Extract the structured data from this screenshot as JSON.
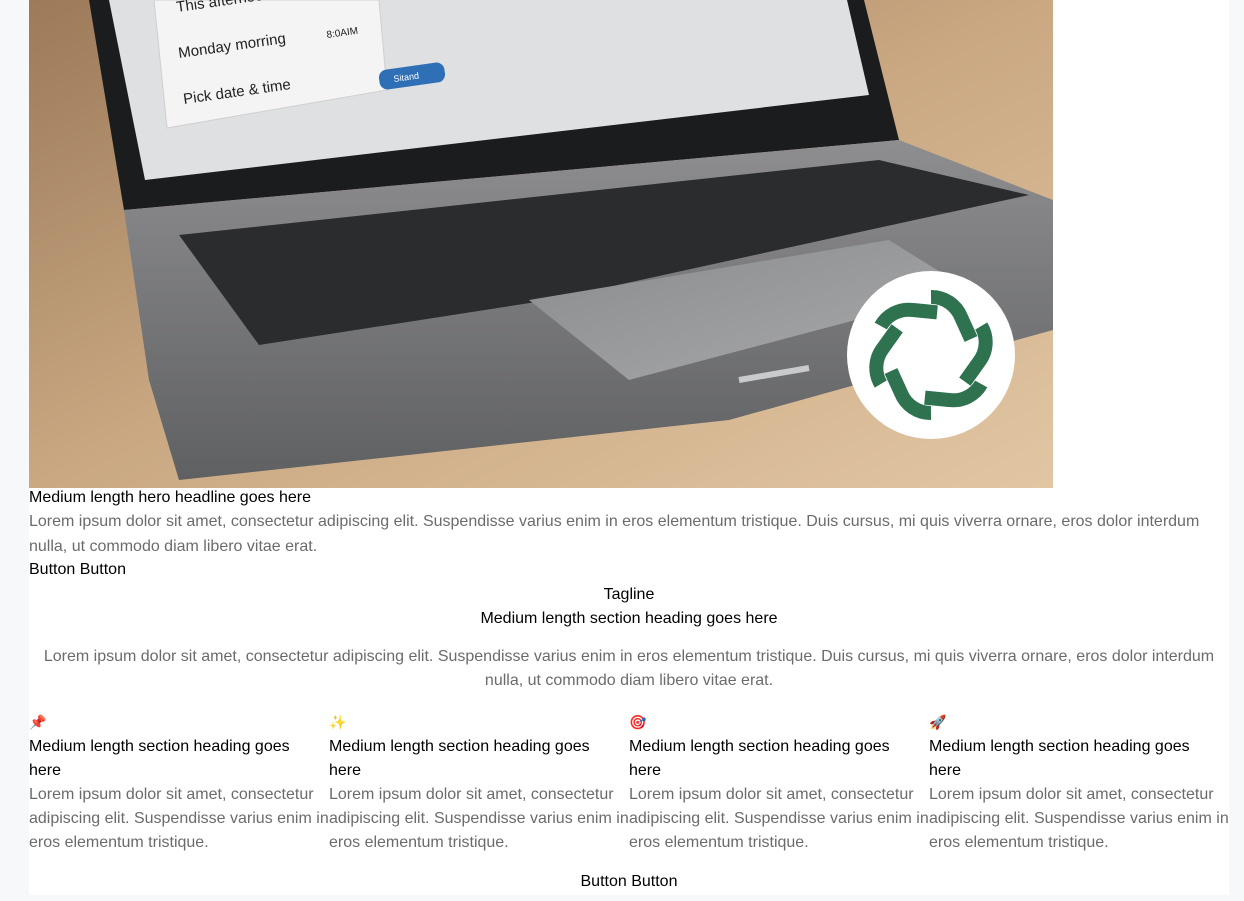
{
  "hero": {
    "image": {
      "menu_items": [
        "This afternoon",
        "Monday morring",
        "Pick date & time"
      ],
      "menu_time": "8:0AIM",
      "send_button": "Sitand"
    },
    "headline": "Medium length hero headline goes here",
    "body": "Lorem ipsum dolor sit amet, consectetur adipiscing elit. Suspendisse varius enim in eros elementum tristique. Duis cursus, mi quis viverra ornare, eros dolor interdum nulla, ut commodo diam libero vitae erat.",
    "button_primary": "Button",
    "button_secondary": "Button"
  },
  "section": {
    "tagline": "Tagline",
    "heading": "Medium length section heading goes here",
    "description": "Lorem ipsum dolor sit amet, consectetur adipiscing elit. Suspendisse varius enim in eros elementum tristique. Duis cursus, mi quis viverra ornare, eros dolor interdum nulla, ut commodo diam libero vitae erat."
  },
  "features": [
    {
      "icon": "📌",
      "icon_name": "pushpin-icon",
      "title": "Medium length section heading goes here",
      "text": "Lorem ipsum dolor sit amet, consectetur adipiscing elit. Suspendisse varius enim in eros elementum tristique."
    },
    {
      "icon": "✨",
      "icon_name": "sparkles-icon",
      "title": "Medium length section heading goes here",
      "text": "Lorem ipsum dolor sit amet, consectetur adipiscing elit. Suspendisse varius enim in eros elementum tristique."
    },
    {
      "icon": "🎯",
      "icon_name": "target-icon",
      "title": "Medium length section heading goes here",
      "text": "Lorem ipsum dolor sit amet, consectetur adipiscing elit. Suspendisse varius enim in eros elementum tristique."
    },
    {
      "icon": "🚀",
      "icon_name": "rocket-icon",
      "title": "Medium length section heading goes here",
      "text": "Lorem ipsum dolor sit amet, consectetur adipiscing elit. Suspendisse varius enim in eros elementum tristique."
    }
  ],
  "bottom": {
    "button_primary": "Button",
    "button_secondary": "Button"
  },
  "colors": {
    "body_text": "#6b6b6b",
    "logo_green": "#2e7250",
    "page_background": "#f7f8fa"
  }
}
